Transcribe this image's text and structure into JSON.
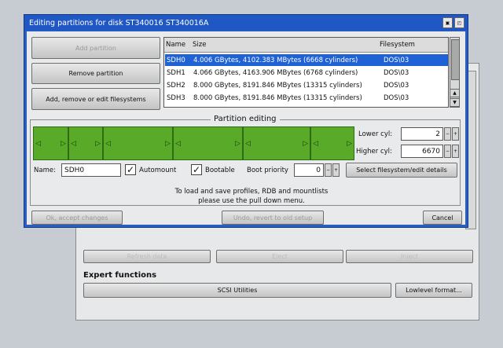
{
  "window": {
    "title": "Editing partitions for disk ST340016 ST340016A"
  },
  "buttons": {
    "add_partition": "Add partition",
    "remove_partition": "Remove partition",
    "add_remove_edit_fs": "Add, remove or edit filesystems"
  },
  "table": {
    "columns": [
      "Name",
      "Size",
      "Filesystem"
    ],
    "rows": [
      {
        "name": "SDH0",
        "size": "4.006 GBytes, 4102.383 MBytes (6668 cylinders)",
        "fs": "DOS\\03"
      },
      {
        "name": "SDH1",
        "size": "4.066 GBytes, 4163.906 MBytes (6768 cylinders)",
        "fs": "DOS\\03"
      },
      {
        "name": "SDH2",
        "size": "8.000 GBytes, 8191.846 MBytes (13315 cylinders)",
        "fs": "DOS\\03"
      },
      {
        "name": "SDH3",
        "size": "8.000 GBytes, 8191.846 MBytes (13315 cylinders)",
        "fs": "DOS\\03"
      }
    ]
  },
  "partition_editing": {
    "title": "Partition editing",
    "lower_cyl_label": "Lower cyl:",
    "lower_cyl": "2",
    "higher_cyl_label": "Higher cyl:",
    "higher_cyl": "6670",
    "name_label": "Name:",
    "name_value": "SDH0",
    "automount_label": "Automount",
    "bootable_label": "Bootable",
    "boot_priority_label": "Boot priority",
    "boot_priority": "0",
    "select_fs_button": "Select filesystem/edit details"
  },
  "info_text": {
    "line1": "To load and save profiles, RDB and mountlists",
    "line2": "please use the pull down menu."
  },
  "footer": {
    "accept": "Ok, accept changes",
    "undo": "Undo, revert to old setup",
    "cancel": "Cancel"
  },
  "background_window": {
    "refresh": "Refresh data",
    "eject": "Eject",
    "inject": "Inject",
    "expert_title": "Expert functions",
    "scsi_utilities": "SCSI Utilities",
    "lowlevel_format": "Lowlevel format..."
  },
  "colors": {
    "titlebar": "#1f57c4",
    "selection": "#1f62d6",
    "partition_green": "#5aaa2a"
  }
}
